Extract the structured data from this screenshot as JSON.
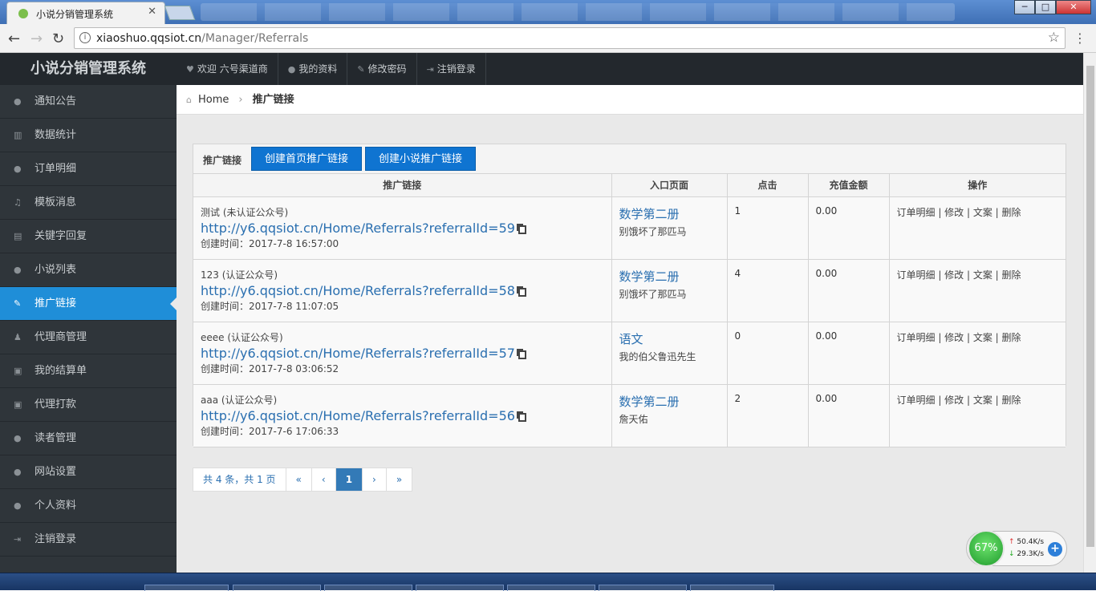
{
  "browser": {
    "tab_title": "小说分销管理系统",
    "tab_close": "✕",
    "url_host": "xiaoshuo.qqsiot.cn",
    "url_path": "/Manager/Referrals",
    "win_min": "─",
    "win_max": "□",
    "win_close": "✕"
  },
  "sidebar": {
    "brand": "小说分销管理系统",
    "items": [
      {
        "label": "通知公告",
        "icon": "person-icon"
      },
      {
        "label": "数据统计",
        "icon": "chart-icon"
      },
      {
        "label": "订单明细",
        "icon": "person-icon"
      },
      {
        "label": "模板消息",
        "icon": "music-icon"
      },
      {
        "label": "关键字回复",
        "icon": "book-icon"
      },
      {
        "label": "小说列表",
        "icon": "person-icon"
      },
      {
        "label": "推广链接",
        "icon": "edit-icon"
      },
      {
        "label": "代理商管理",
        "icon": "user-icon"
      },
      {
        "label": "我的结算单",
        "icon": "money-icon"
      },
      {
        "label": "代理打款",
        "icon": "money-icon"
      },
      {
        "label": "读者管理",
        "icon": "person-icon"
      },
      {
        "label": "网站设置",
        "icon": "person-icon"
      },
      {
        "label": "个人资料",
        "icon": "person-icon"
      },
      {
        "label": "注销登录",
        "icon": "logout-icon"
      }
    ]
  },
  "topbar": {
    "welcome": "欢迎 六号渠道商",
    "profile": "我的资料",
    "password": "修改密码",
    "logout": "注销登录"
  },
  "breadcrumb": {
    "home": "Home",
    "current": "推广链接"
  },
  "panel": {
    "label": "推广链接",
    "btn_home": "创建首页推广链接",
    "btn_novel": "创建小说推广链接"
  },
  "table": {
    "headers": [
      "推广链接",
      "入口页面",
      "点击",
      "充值金额",
      "操作"
    ],
    "rows": [
      {
        "wx": "测试 (未认证公众号)",
        "url": "http://y6.qqsiot.cn/Home/Referrals?referralId=59",
        "time": "创建时间：2017-7-8 16:57:00",
        "book": "数学第二册",
        "chapter": "别饿坏了那匹马",
        "clicks": "1",
        "amount": "0.00",
        "ops": "订单明细 | 修改 | 文案 | 删除"
      },
      {
        "wx": "123 (认证公众号)",
        "url": "http://y6.qqsiot.cn/Home/Referrals?referralId=58",
        "time": "创建时间：2017-7-8 11:07:05",
        "book": "数学第二册",
        "chapter": "别饿坏了那匹马",
        "clicks": "4",
        "amount": "0.00",
        "ops": "订单明细 | 修改 | 文案 | 删除"
      },
      {
        "wx": "eeee (认证公众号)",
        "url": "http://y6.qqsiot.cn/Home/Referrals?referralId=57",
        "time": "创建时间：2017-7-8 03:06:52",
        "book": "语文",
        "chapter": "我的伯父鲁迅先生",
        "clicks": "0",
        "amount": "0.00",
        "ops": "订单明细 | 修改 | 文案 | 删除"
      },
      {
        "wx": "aaa (认证公众号)",
        "url": "http://y6.qqsiot.cn/Home/Referrals?referralId=56",
        "time": "创建时间：2017-7-6 17:06:33",
        "book": "数学第二册",
        "chapter": "詹天佑",
        "clicks": "2",
        "amount": "0.00",
        "ops": "订单明细 | 修改 | 文案 | 删除"
      }
    ]
  },
  "pager": {
    "summary": "共 4 条，共 1 页",
    "first": "«",
    "prev": "‹",
    "current": "1",
    "next": "›",
    "last": "»"
  },
  "netwidget": {
    "percent": "67%",
    "up": "50.4K/s",
    "down": "29.3K/s",
    "plus": "+"
  },
  "colors": {
    "sidebar_bg": "#2f353a",
    "active": "#1f8ed8",
    "button": "#0f74d1",
    "link": "#2a6fb0"
  }
}
